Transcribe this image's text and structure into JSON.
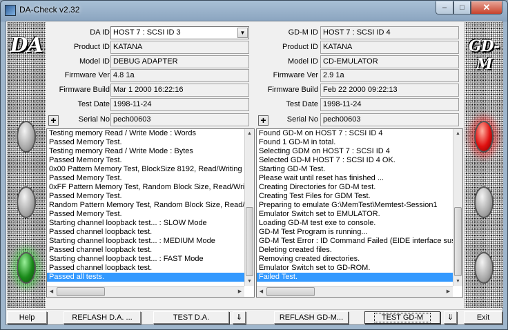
{
  "window": {
    "title": "DA-Check v2.32",
    "minimize_glyph": "–",
    "maximize_glyph": "□",
    "close_glyph": "✕"
  },
  "left_panel": {
    "logo": "DA"
  },
  "right_panel": {
    "logo": "GD-M"
  },
  "da": {
    "fields": [
      {
        "label": "DA ID",
        "value": "HOST 7 : SCSI ID 3",
        "type": "combo"
      },
      {
        "label": "Product ID",
        "value": "KATANA"
      },
      {
        "label": "Model ID",
        "value": "DEBUG ADAPTER"
      },
      {
        "label": "Firmware Ver",
        "value": "4.8 1a"
      },
      {
        "label": "Firmware Build",
        "value": "Mar  1 2000 16:22:16"
      },
      {
        "label": "Test Date",
        "value": "1998-11-24"
      },
      {
        "label": "Serial No",
        "value": "pech00603"
      }
    ],
    "log": [
      "Testing memory Read / Write Mode : Words",
      "Passed Memory Test.",
      "Testing memory Read / Write Mode : Bytes",
      "Passed Memory Test.",
      "0x00 Pattern Memory Test, BlockSize 8192, Read/Writing B",
      "Passed Memory Test.",
      "0xFF Pattern Memory Test, Random Block Size, Read/Writi",
      "Passed Memory Test.",
      "Random Pattern Memory Test, Random Block Size, Read/W",
      "Passed Memory Test.",
      "Starting channel loopback test... : SLOW Mode",
      "Passed channel loopback test.",
      "Starting channel loopback test... : MEDIUM Mode",
      "Passed channel loopback test.",
      "Starting channel loopback test... : FAST Mode",
      "Passed channel loopback test.",
      "Passed all tests."
    ]
  },
  "gdm": {
    "fields": [
      {
        "label": "GD-M ID",
        "value": "HOST 7 : SCSI ID 4"
      },
      {
        "label": "Product ID",
        "value": "KATANA"
      },
      {
        "label": "Model ID",
        "value": "CD-EMULATOR"
      },
      {
        "label": "Firmware Ver",
        "value": "2.9 1a"
      },
      {
        "label": "Firmware Build",
        "value": "Feb 22 2000 09:22:13"
      },
      {
        "label": "Test Date",
        "value": "1998-11-24"
      },
      {
        "label": "Serial No",
        "value": "pech00603"
      }
    ],
    "log": [
      "Found GD-M on HOST 7 : SCSI ID 4",
      "Found 1 GD-M in total.",
      "Selecting GDM on HOST 7 : SCSI ID 4",
      "Selected GD-M HOST 7 : SCSI ID 4 OK.",
      "Starting GD-M Test.",
      "Please wait until reset has finished ...",
      "Creating Directories for GD-M test.",
      "Creating Test Files for GDM Test.",
      "Preparing to emulate G:\\MemTest\\Memtest-Session1",
      "Emulator Switch set to EMULATOR.",
      "Loading GD-M test exe to console.",
      "GD-M Test Program is running...",
      "GD-M Test Error : ID Command Failed (EIDE interface suspe",
      "Deleting created files.",
      "Removing created directories.",
      "Emulator Switch set to GD-ROM.",
      "Failed Test."
    ]
  },
  "buttons": {
    "help": "Help",
    "reflash_da": "REFLASH D.A. ...",
    "test_da": "TEST D.A.",
    "down": "⇓",
    "reflash_gdm": "REFLASH GD-M...",
    "test_gdm": "TEST GD-M",
    "exit": "Exit",
    "plus": "+"
  },
  "status": {
    "da_lamp": "green",
    "gdm_lamp": "red"
  },
  "colors": {
    "selection": "#3399ff",
    "pass_lamp": "#1a8a1a",
    "fail_lamp": "#e01010"
  }
}
